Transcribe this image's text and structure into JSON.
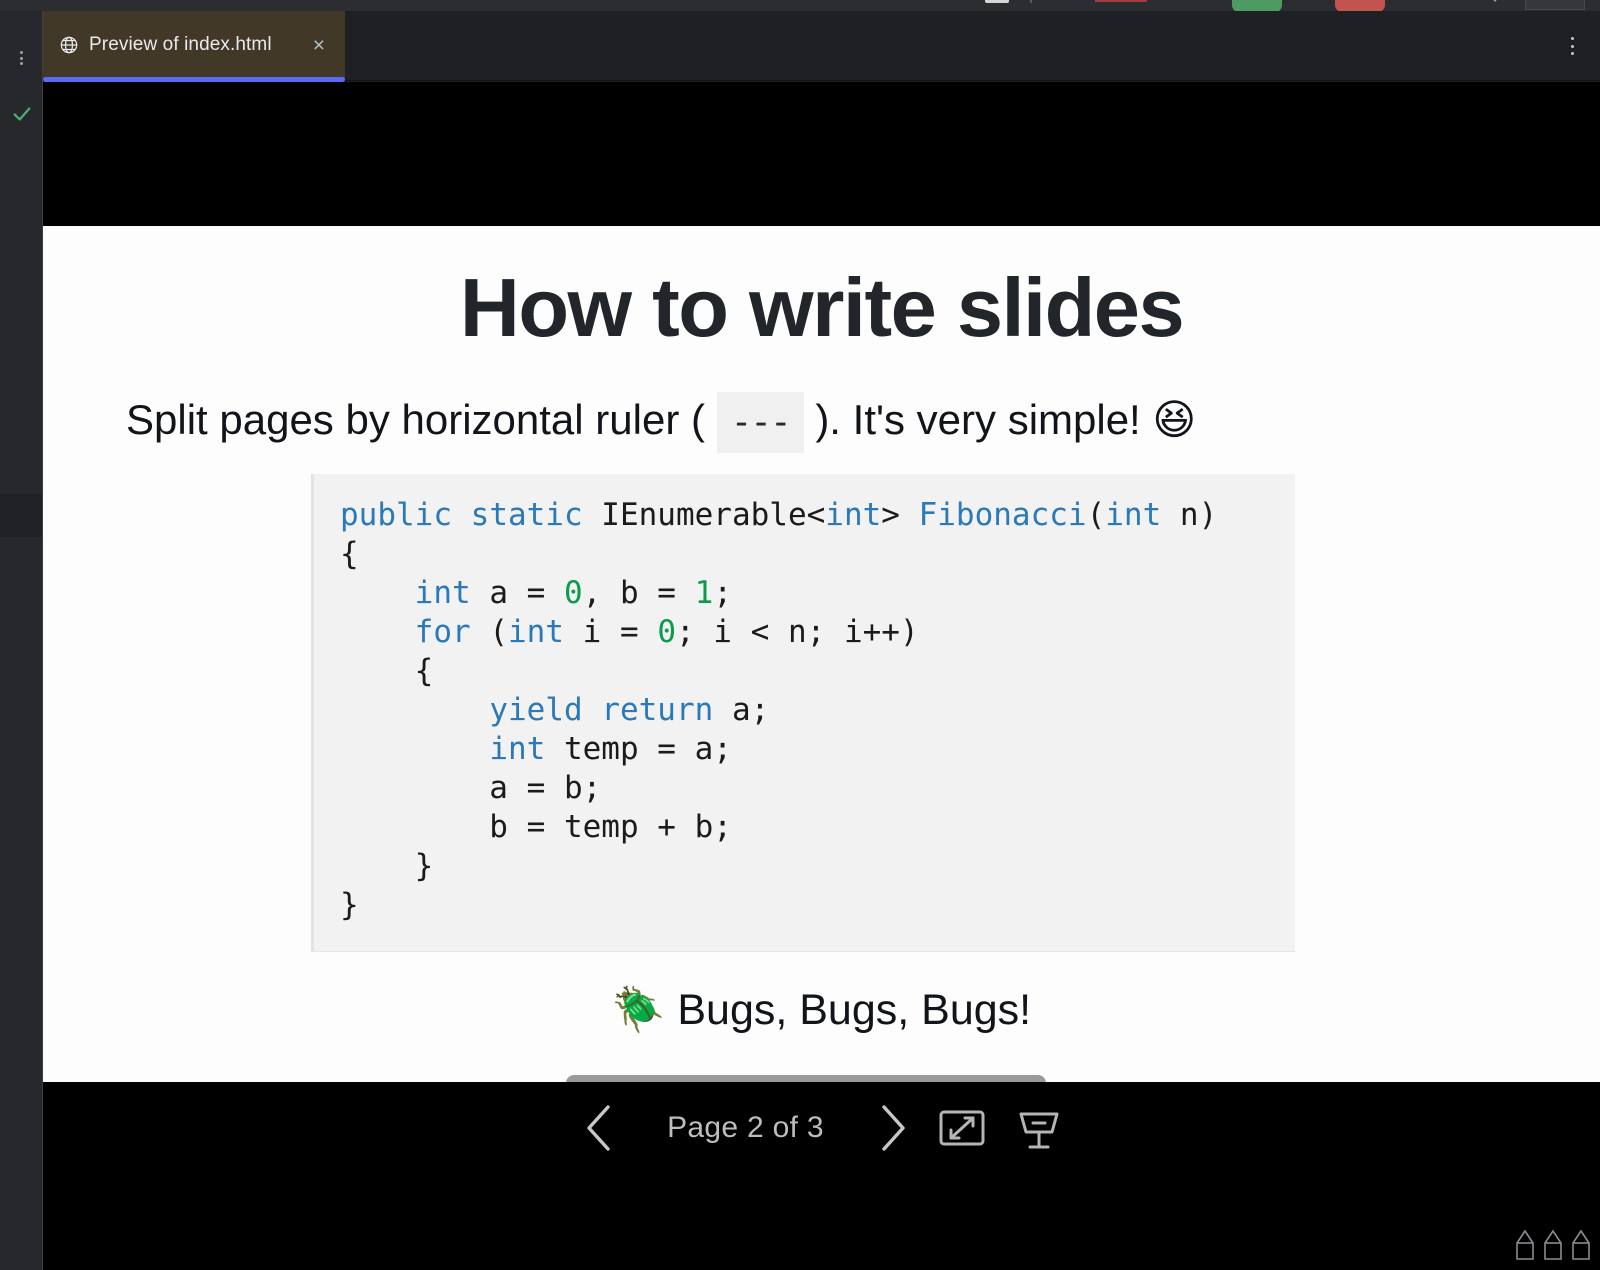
{
  "window": {
    "rail": {
      "kebab_label": "⋮",
      "check_icon": "check-icon"
    },
    "top_toolbar": {
      "green_chip": "",
      "red_chip": ""
    }
  },
  "tab": {
    "icon": "globe-icon",
    "title": "Preview of index.html",
    "close_label": "×",
    "accent_color": "#5a6cf5",
    "background_color": "#413827"
  },
  "overflow_menu": {
    "label": "⋮"
  },
  "slide": {
    "title": "How to write slides",
    "subtitle_before": "Split pages by horizontal ruler ( ",
    "subtitle_code": "---",
    "subtitle_after": " ). It's very simple! ",
    "subtitle_emoji": "😆",
    "code": {
      "language": "csharp",
      "lines": [
        "public static IEnumerable<int> Fibonacci(int n)",
        "{",
        "    int a = 0, b = 1;",
        "    for (int i = 0; i < n; i++)",
        "    {",
        "        yield return a;",
        "        int temp = a;",
        "        a = b;",
        "        b = temp + b;",
        "    }",
        "}"
      ],
      "keyword_color": "#2b79b8",
      "number_color": "#0a9b4b",
      "background_color": "#f2f2f2"
    },
    "footer_emoji": "🪲",
    "footer_text": " Bugs, Bugs, Bugs!"
  },
  "controls": {
    "prev_label": "previous-page",
    "page_indicator": "Page 2 of 3",
    "next_label": "next-page",
    "fullscreen_label": "fullscreen",
    "presenter_label": "presenter-mode"
  },
  "status": {
    "pencils": "AAA"
  }
}
